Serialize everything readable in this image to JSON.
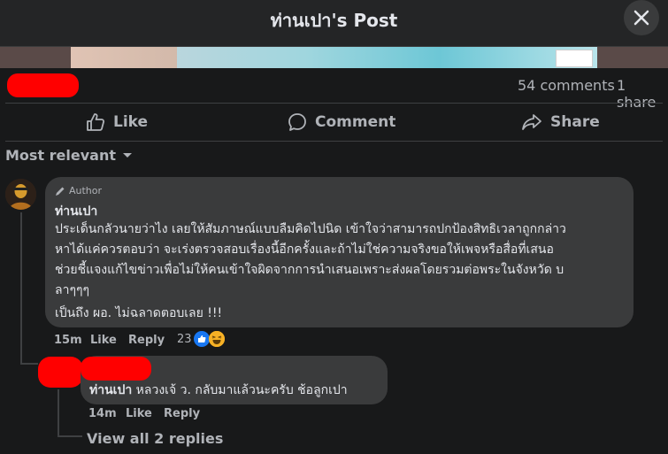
{
  "header": {
    "title": "ท่านเปา's Post"
  },
  "stats": {
    "comments": "54 comments",
    "shares": "1 share"
  },
  "actions": {
    "like": "Like",
    "comment": "Comment",
    "share": "Share"
  },
  "sort": {
    "label": "Most relevant"
  },
  "comment": {
    "badge": "Author",
    "name": "ท่านเปา",
    "lines": [
      "ประเด็นกลัวนายว่าไง เลยให้สัมภาษณ์แบบลืมคิดไปนิด เข้าใจว่าสามารถปกป้องสิทธิเวลาถูกกล่าว",
      "หาได้แค่ควรตอบว่า จะเร่งตรวจสอบเรื่องนี้อีกครั้งและถ้าไม่ใช่ความจริงขอให้เพจหรือสื่อที่เสนอ",
      "ช่วยชี้แจงแก้ไขข่าวเพื่อไม่ให้คนเข้าใจผิดจากการนำเสนอเพราะส่งผลโดยรวมต่อพระในจังหวัด บ",
      "ลาๆๆๆ"
    ],
    "line2": "เป็นถึง ผอ. ไม่ฉลาดตอบเลย !!!",
    "time": "15m",
    "like": "Like",
    "reply": "Reply",
    "reaction_count": "23"
  },
  "reply": {
    "name": "ท่านเปา",
    "text": " หลวงเจ้ ว. กลับมาแล้วนะครับ ช้อลูกเปา",
    "time": "14m",
    "like": "Like",
    "reply": "Reply"
  },
  "view_replies": "View all 2 replies",
  "colors": {
    "background": "#18191a",
    "surface": "#242526",
    "bubble": "#3a3b3c",
    "redact": "#ff0000"
  }
}
